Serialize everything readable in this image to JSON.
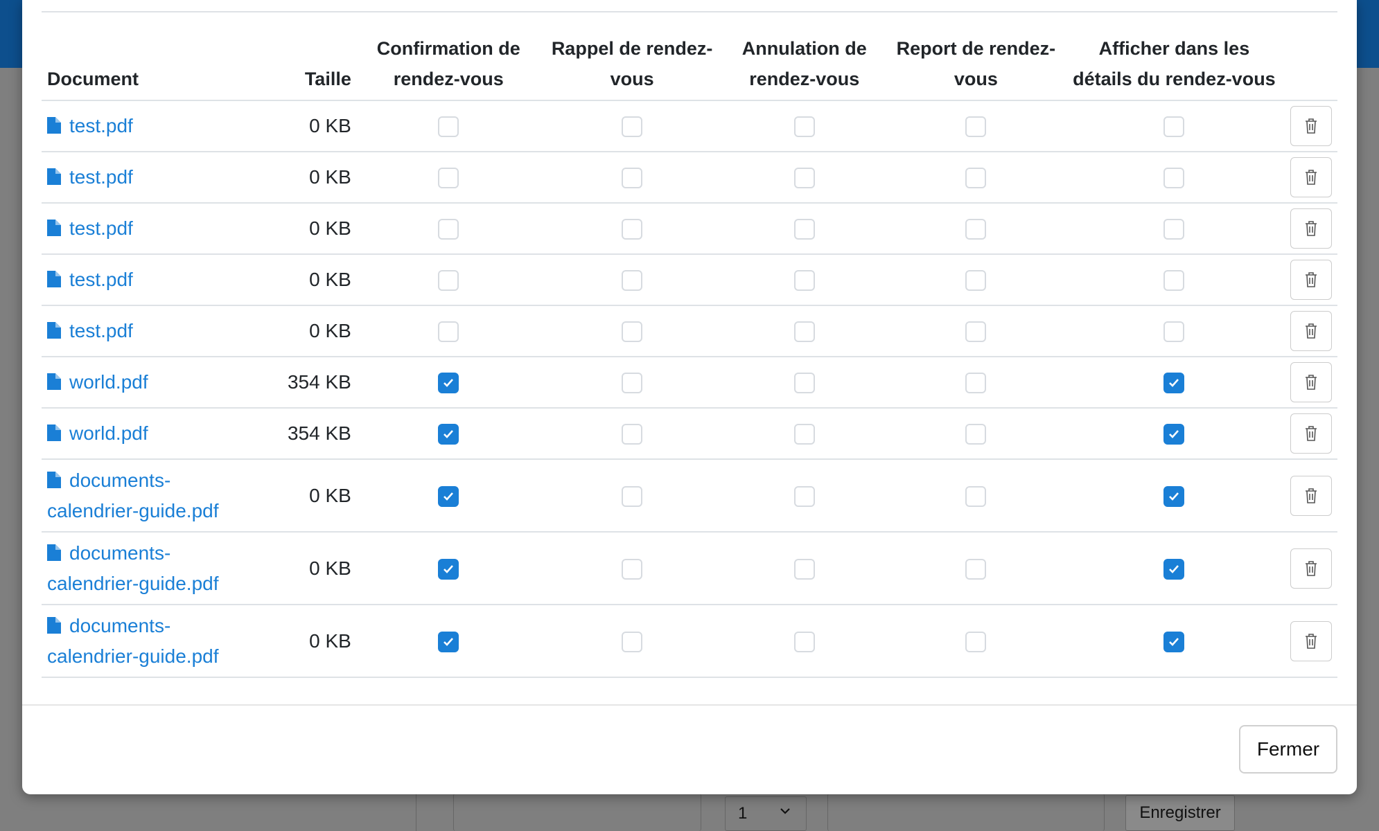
{
  "background": {
    "page_select_value": "1",
    "save_label": "Enregistrer"
  },
  "table": {
    "headers": {
      "document": "Document",
      "size": "Taille",
      "confirmation": "Confirmation de rendez-vous",
      "reminder": "Rappel de rendez-vous",
      "cancellation": "Annulation de rendez-vous",
      "postponement": "Report de rendez-vous",
      "details": "Afficher dans les détails du rendez-vous"
    },
    "rows": [
      {
        "name": "test.pdf",
        "size": "0 KB",
        "confirmation": false,
        "reminder": false,
        "cancellation": false,
        "postponement": false,
        "details": false
      },
      {
        "name": "test.pdf",
        "size": "0 KB",
        "confirmation": false,
        "reminder": false,
        "cancellation": false,
        "postponement": false,
        "details": false
      },
      {
        "name": "test.pdf",
        "size": "0 KB",
        "confirmation": false,
        "reminder": false,
        "cancellation": false,
        "postponement": false,
        "details": false
      },
      {
        "name": "test.pdf",
        "size": "0 KB",
        "confirmation": false,
        "reminder": false,
        "cancellation": false,
        "postponement": false,
        "details": false
      },
      {
        "name": "test.pdf",
        "size": "0 KB",
        "confirmation": false,
        "reminder": false,
        "cancellation": false,
        "postponement": false,
        "details": false
      },
      {
        "name": "world.pdf",
        "size": "354 KB",
        "confirmation": true,
        "reminder": false,
        "cancellation": false,
        "postponement": false,
        "details": true
      },
      {
        "name": "world.pdf",
        "size": "354 KB",
        "confirmation": true,
        "reminder": false,
        "cancellation": false,
        "postponement": false,
        "details": true
      },
      {
        "name": "documents-calendrier-guide.pdf",
        "size": "0 KB",
        "confirmation": true,
        "reminder": false,
        "cancellation": false,
        "postponement": false,
        "details": true
      },
      {
        "name": "documents-calendrier-guide.pdf",
        "size": "0 KB",
        "confirmation": true,
        "reminder": false,
        "cancellation": false,
        "postponement": false,
        "details": true
      },
      {
        "name": "documents-calendrier-guide.pdf",
        "size": "0 KB",
        "confirmation": true,
        "reminder": false,
        "cancellation": false,
        "postponement": false,
        "details": true
      }
    ]
  },
  "footer": {
    "close_label": "Fermer"
  },
  "colors": {
    "accent": "#1a7fd6",
    "header_bg": "#0d4f8d",
    "overlay": "#7f7f7f"
  },
  "icons": {
    "file": "file-icon",
    "delete": "trash-icon",
    "check": "check-icon",
    "chevron": "chevron-down-icon"
  }
}
